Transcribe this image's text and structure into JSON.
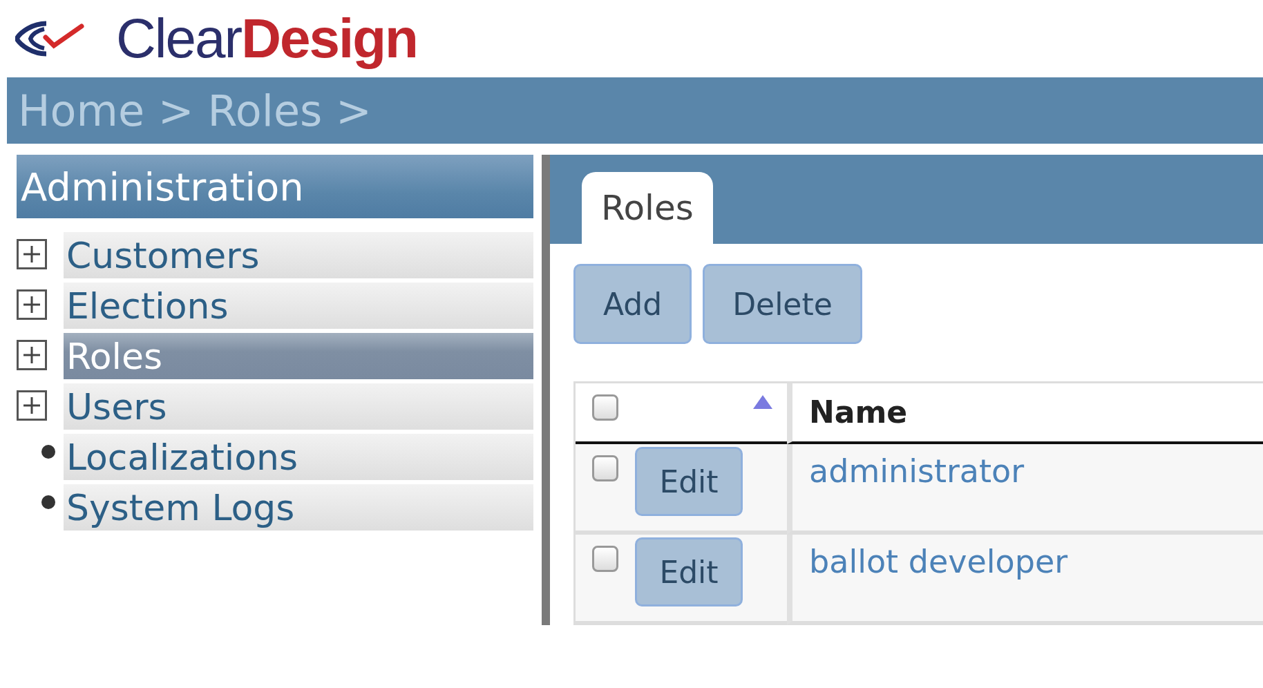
{
  "logo": {
    "first": "Clear",
    "second": "Design"
  },
  "breadcrumb": "Home > Roles >",
  "sidebar": {
    "title": "Administration",
    "items": [
      {
        "label": "Customers",
        "kind": "group",
        "expanded": false,
        "selected": false
      },
      {
        "label": "Elections",
        "kind": "group",
        "expanded": false,
        "selected": false
      },
      {
        "label": "Roles",
        "kind": "group",
        "expanded": false,
        "selected": true
      },
      {
        "label": "Users",
        "kind": "group",
        "expanded": false,
        "selected": false
      },
      {
        "label": "Localizations",
        "kind": "leaf",
        "selected": false
      },
      {
        "label": "System Logs",
        "kind": "leaf",
        "selected": false
      }
    ]
  },
  "tabs": [
    {
      "label": "Roles",
      "selected": true
    }
  ],
  "toolbar": [
    "Add",
    "Delete"
  ],
  "table": {
    "select_all": {
      "checked": false
    },
    "columns": [
      "Name"
    ],
    "rows": [
      {
        "checked": false,
        "action": "Edit",
        "name": "administrator"
      },
      {
        "checked": false,
        "action": "Edit",
        "name": "ballot developer"
      }
    ]
  }
}
